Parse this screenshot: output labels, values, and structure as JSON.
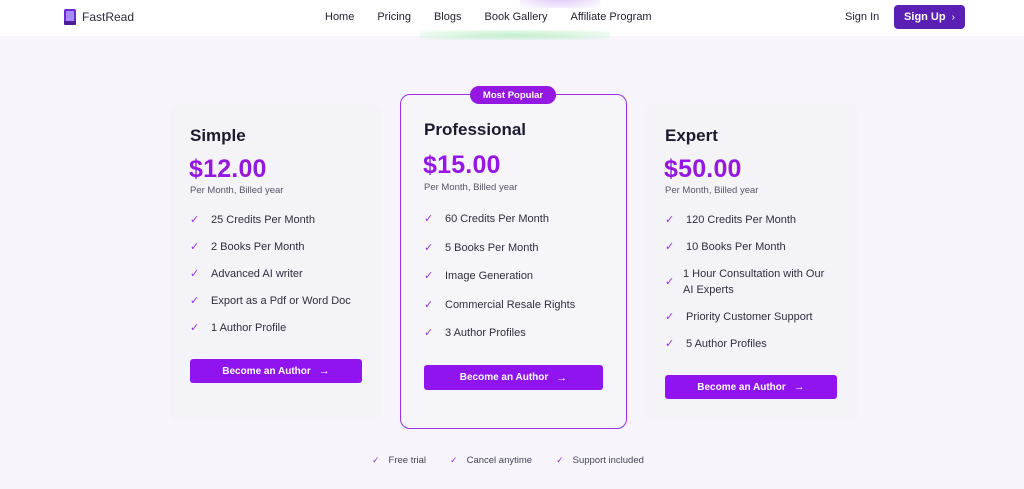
{
  "header": {
    "brand": "FastRead",
    "nav": [
      "Home",
      "Pricing",
      "Blogs",
      "Book Gallery",
      "Affiliate Program"
    ],
    "signin": "Sign In",
    "signup": "Sign Up",
    "accent": "#5a1fb3"
  },
  "plans": [
    {
      "name": "Simple",
      "price": "$12.00",
      "billing": "Per Month, Billed year",
      "features": [
        "25 Credits Per Month",
        "2 Books Per Month",
        "Advanced AI writer",
        "Export as a Pdf or Word Doc",
        "1 Author Profile"
      ],
      "cta": "Become an Author"
    },
    {
      "name": "Professional",
      "badge": "Most Popular",
      "price": "$15.00",
      "billing": "Per Month, Billed year",
      "features": [
        "60 Credits Per Month",
        "5 Books Per Month",
        "Image Generation",
        "Commercial Resale Rights",
        "3 Author Profiles"
      ],
      "cta": "Become an Author"
    },
    {
      "name": "Expert",
      "price": "$50.00",
      "billing": "Per Month, Billed year",
      "features": [
        "120 Credits Per Month",
        "10 Books Per Month",
        "1 Hour Consultation with Our AI Experts",
        "Priority Customer Support",
        "5 Author Profiles"
      ],
      "cta": "Become an Author"
    }
  ],
  "perks": [
    "Free trial",
    "Cancel anytime",
    "Support included"
  ],
  "colors": {
    "price": "#9417e2",
    "button": "#8f14f0",
    "featured_border": "#9b30e3"
  },
  "icons": {
    "check": "check-icon",
    "arrow": "arrow-right-icon",
    "chevron": "chevron-right-icon",
    "logo": "book-logo-icon"
  }
}
